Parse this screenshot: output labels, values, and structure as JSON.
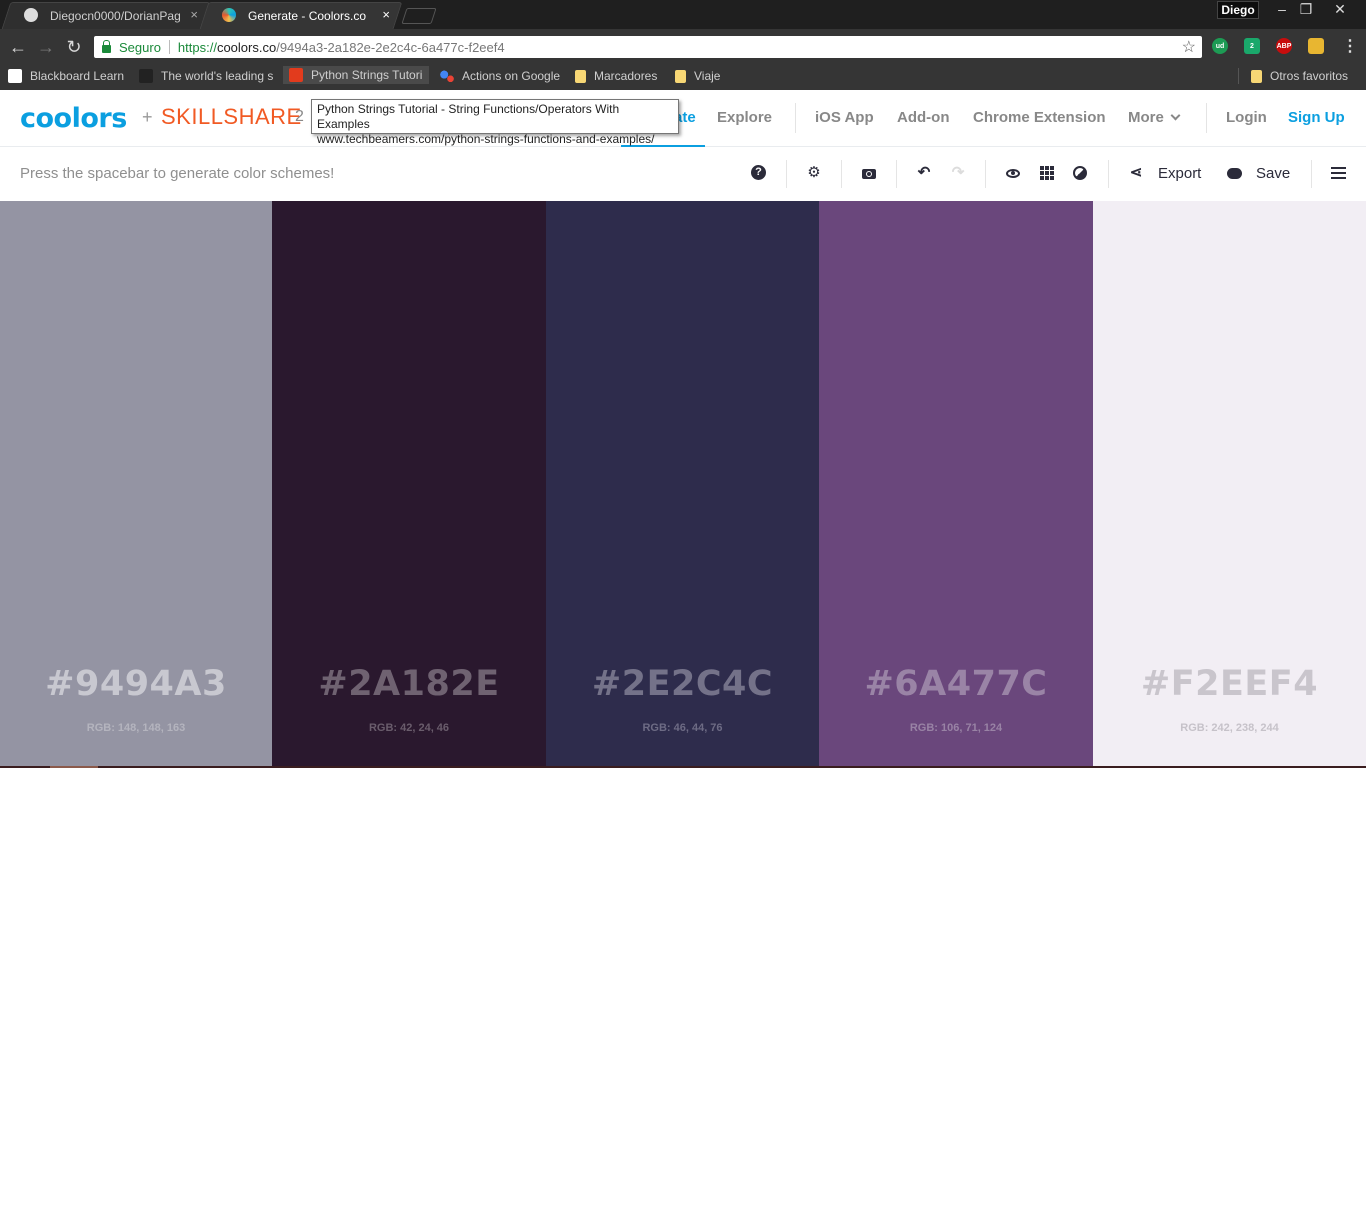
{
  "browser": {
    "tabs": [
      {
        "title": "Diegocn0000/DorianPag",
        "close": "×",
        "active": false
      },
      {
        "title": "Generate - Coolors.co",
        "close": "×",
        "active": true
      }
    ],
    "profile": "Diego",
    "window_controls": {
      "minimize": "–",
      "restore": "❐",
      "close": "✕"
    },
    "nav": {
      "back": "←",
      "forward": "→",
      "reload": "↻"
    },
    "omnibox": {
      "secure_label": "Seguro",
      "url_scheme": "https://",
      "url_host": "coolors.co",
      "url_path": "/9494a3-2a182e-2e2c4c-6a477c-f2eef4",
      "star": "☆"
    },
    "extensions": [
      {
        "name": "ud",
        "color": "#1d9b54"
      },
      {
        "name": "2",
        "color": "#1aa86b"
      },
      {
        "name": "ABP",
        "color": "#c70d0d"
      },
      {
        "name": "",
        "color": "#e8b631"
      }
    ],
    "menu": "⋮",
    "bookmarks": [
      {
        "label": "Blackboard Learn"
      },
      {
        "label": "The world's leading s"
      },
      {
        "label": "Python Strings Tutori"
      },
      {
        "label": "Actions on Google"
      },
      {
        "label": "Marcadores"
      },
      {
        "label": "Viaje"
      }
    ],
    "other_bookmarks": "Otros favoritos",
    "tooltip": {
      "line1": "Python Strings Tutorial - String Functions/Operators With Examples",
      "line2": "www.techbeamers.com/python-strings-functions-and-examples/"
    }
  },
  "site": {
    "logo": "coolors",
    "plus": "+",
    "partner": "SKILLSHARE",
    "partner_extra": "2",
    "nav": {
      "generate_partial": "ate",
      "explore": "Explore",
      "ios": "iOS App",
      "addon": "Add-on",
      "chrome_ext": "Chrome Extension",
      "more": "More",
      "login": "Login",
      "signup": "Sign Up"
    },
    "toolbar": {
      "hint": "Press the spacebar to generate color schemes!",
      "help": "?",
      "settings": "⚙",
      "undo": "↶",
      "redo": "↷",
      "share": "⋖",
      "export": "Export",
      "save": "Save"
    }
  },
  "palette": [
    {
      "hex": "#9494A3",
      "rgb": "RGB: 148, 148, 163",
      "color": "#9494a3",
      "text_color": "#c8c8d0",
      "rgb_color": "#b4b4be"
    },
    {
      "hex": "#2A182E",
      "rgb": "RGB: 42, 24, 46",
      "color": "#2a182e",
      "text_color": "#6f6271",
      "rgb_color": "#6a5d6c"
    },
    {
      "hex": "#2E2C4C",
      "rgb": "RGB: 46, 44, 76",
      "color": "#2e2c4c",
      "text_color": "#747289",
      "rgb_color": "#6d6b84"
    },
    {
      "hex": "#6A477C",
      "rgb": "RGB: 106, 71, 124",
      "color": "#6a477c",
      "text_color": "#9a84a6",
      "rgb_color": "#9983a5"
    },
    {
      "hex": "#F2EEF4",
      "rgb": "RGB: 242, 238, 244",
      "color": "#f2eef4",
      "text_color": "#c9c5cc",
      "rgb_color": "#c6c2c9"
    }
  ]
}
